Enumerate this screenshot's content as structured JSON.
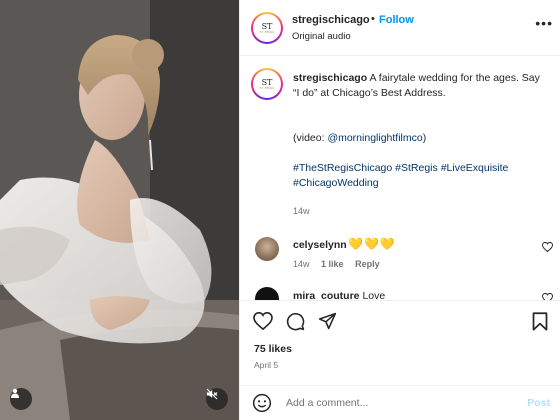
{
  "post": {
    "username": "stregischicago",
    "follow_label": "Follow",
    "separator": "•",
    "audio": "Original audio",
    "more": "•••"
  },
  "brand": {
    "mark": "ST",
    "logo_text": "ST REGIS"
  },
  "caption": {
    "username": "stregischicago",
    "text": " A fairytale wedding for the ages. Say “I do” at Chicago’s Best Address.",
    "video_prefix": "(video: ",
    "video_handle": "@morninglightfilmco",
    "video_suffix": ")",
    "hashtags": [
      "#TheStRegisChicago",
      "#StRegis",
      "#LiveExquisite",
      "#ChicagoWedding"
    ],
    "time": "14w"
  },
  "comments": [
    {
      "username": "celyselynn",
      "text": "💛💛💛",
      "time": "14w",
      "likes": "1 like",
      "reply": "Reply"
    },
    {
      "username": "mira_couture",
      "text": " Love"
    }
  ],
  "footer": {
    "likes": "75 likes",
    "date": "April 5"
  },
  "add_comment": {
    "placeholder": "Add a comment...",
    "post_label": "Post"
  },
  "icons": {
    "media_user": "user-icon",
    "media_mute": "mute-icon",
    "like": "heart-icon",
    "comment": "comment-icon",
    "share": "share-icon",
    "save": "bookmark-icon",
    "emoji": "emoji-icon",
    "more": "more-icon"
  },
  "colors": {
    "accent": "#0095f6",
    "link": "#00376b",
    "muted": "#737373",
    "post_disabled": "#b2dffc"
  }
}
